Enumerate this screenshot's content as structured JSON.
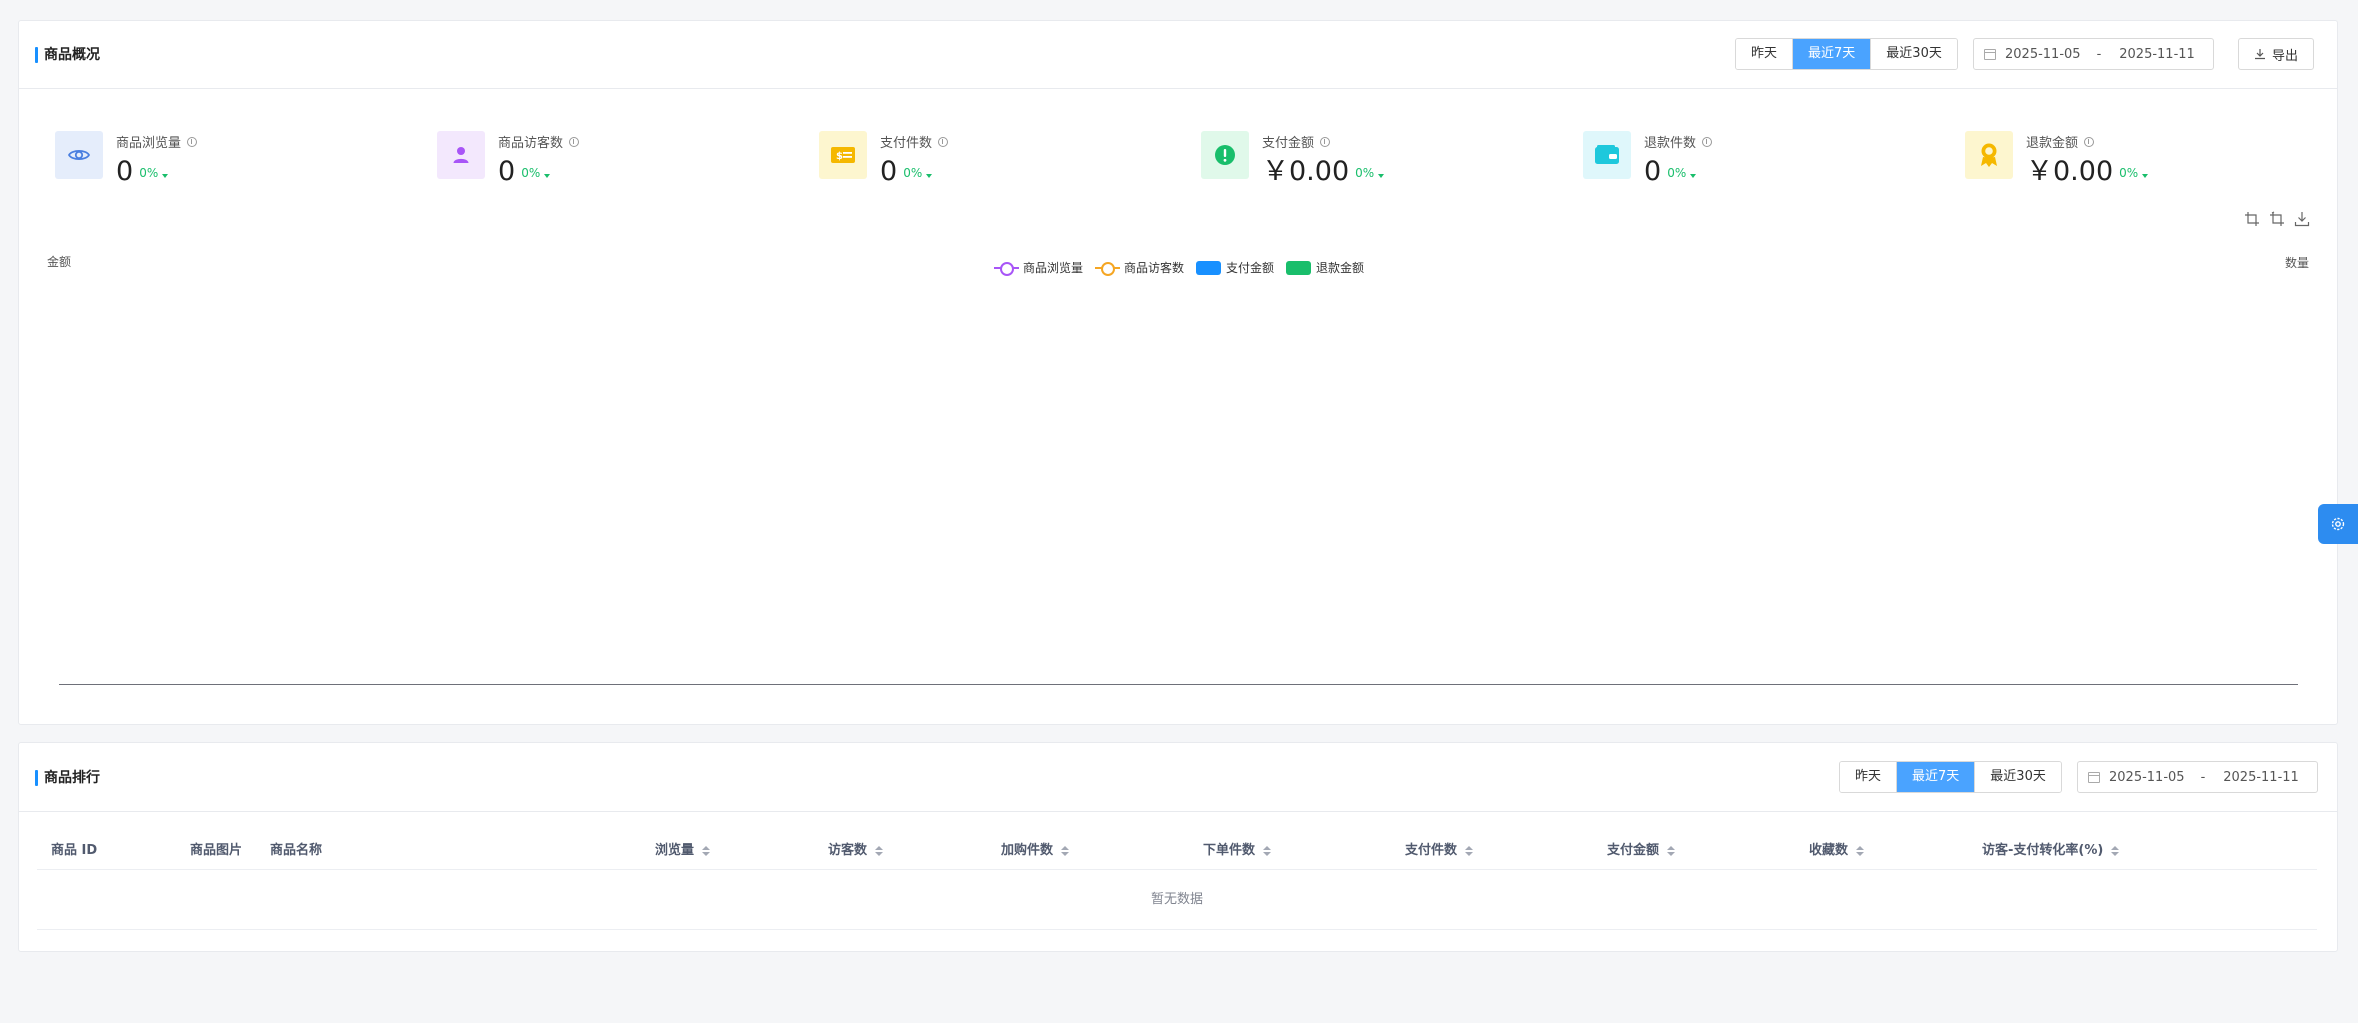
{
  "overview": {
    "title": "商品概况",
    "periods": [
      "昨天",
      "最近7天",
      "最近30天"
    ],
    "active_period": "最近7天",
    "date_start": "2025-11-05",
    "date_separator": "-",
    "date_end": "2025-11-11",
    "export_label": "导出",
    "stats": [
      {
        "label": "商品浏览量",
        "value": "0",
        "trend": "0%",
        "icon": "eye-icon",
        "icon_color": "#4a7fe0",
        "bg_color": "#e5edfb"
      },
      {
        "label": "商品访客数",
        "value": "0",
        "trend": "0%",
        "icon": "user-icon",
        "icon_color": "#a855f7",
        "bg_color": "#f3e8fd"
      },
      {
        "label": "支付件数",
        "value": "0",
        "trend": "0%",
        "icon": "payment-card-icon",
        "icon_color": "#f5b800",
        "bg_color": "#fdf6cf"
      },
      {
        "label": "支付金额",
        "value": "￥0.00",
        "trend": "0%",
        "icon": "money-icon",
        "icon_color": "#19be6b",
        "bg_color": "#e0f9ea"
      },
      {
        "label": "退款件数",
        "value": "0",
        "trend": "0%",
        "icon": "wallet-icon",
        "icon_color": "#1ec8dc",
        "bg_color": "#dff7fb"
      },
      {
        "label": "退款金额",
        "value": "￥0.00",
        "trend": "0%",
        "icon": "award-icon",
        "icon_color": "#f5b800",
        "bg_color": "#fdf6cf"
      }
    ]
  },
  "chart_data": {
    "type": "line",
    "title": "",
    "ylabel_left": "金额",
    "ylabel_right": "数量",
    "categories": [],
    "series": [
      {
        "name": "商品浏览量",
        "kind": "line",
        "color": "#a855f7",
        "values": []
      },
      {
        "name": "商品访客数",
        "kind": "line",
        "color": "#f5a623",
        "values": []
      },
      {
        "name": "支付金额",
        "kind": "bar",
        "color": "#1890ff",
        "values": []
      },
      {
        "name": "退款金额",
        "kind": "bar",
        "color": "#19be6b",
        "values": []
      }
    ],
    "legend_position": "top-center"
  },
  "ranking": {
    "title": "商品排行",
    "periods": [
      "昨天",
      "最近7天",
      "最近30天"
    ],
    "active_period": "最近7天",
    "date_start": "2025-11-05",
    "date_separator": "-",
    "date_end": "2025-11-11",
    "columns": [
      {
        "label": "商品 ID",
        "sortable": false
      },
      {
        "label": "商品图片",
        "sortable": false
      },
      {
        "label": "商品名称",
        "sortable": false
      },
      {
        "label": "浏览量",
        "sortable": true
      },
      {
        "label": "访客数",
        "sortable": true
      },
      {
        "label": "加购件数",
        "sortable": true
      },
      {
        "label": "下单件数",
        "sortable": true
      },
      {
        "label": "支付件数",
        "sortable": true
      },
      {
        "label": "支付金额",
        "sortable": true
      },
      {
        "label": "收藏数",
        "sortable": true
      },
      {
        "label": "访客-支付转化率(%)",
        "sortable": true
      }
    ],
    "empty_text": "暂无数据"
  }
}
